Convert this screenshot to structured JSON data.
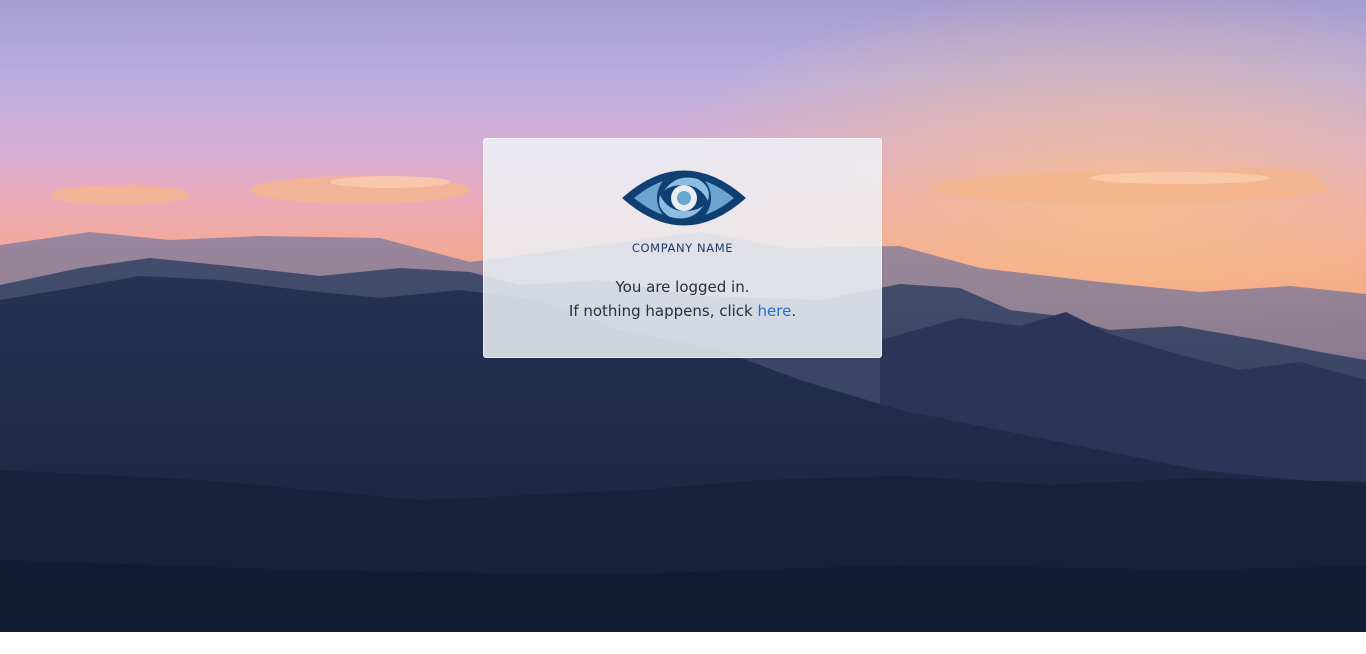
{
  "background": {
    "description_icon": "mountain-sunset-landscape"
  },
  "card": {
    "logo_icon": "eye-icon",
    "company_name": "COMPANY NAME",
    "message_line1": "You are logged in.",
    "message_line2_prefix": "If nothing happens, click ",
    "link_text": "here",
    "message_line2_suffix": "."
  },
  "colors": {
    "link": "#1f6fd0",
    "logo_dark": "#0f3f73",
    "logo_light": "#6aa6cf",
    "company_text": "#1c3a66"
  }
}
